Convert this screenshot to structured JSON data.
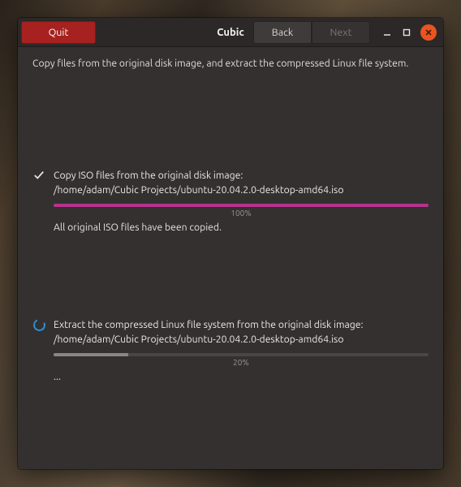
{
  "header": {
    "quit_label": "Quit",
    "app_title": "Cubic",
    "back_label": "Back",
    "next_label": "Next"
  },
  "description": "Copy files from the original disk image, and extract the compressed Linux file system.",
  "tasks": [
    {
      "icon": "check",
      "title": "Copy ISO files from the original disk image:",
      "path": "/home/adam/Cubic Projects/ubuntu-20.04.2.0-desktop-amd64.iso",
      "progress_percent": 100,
      "progress_label": "100%",
      "status": "All original ISO files have been copied."
    },
    {
      "icon": "spinner",
      "title": "Extract the compressed Linux file system from the original disk image:",
      "path": "/home/adam/Cubic Projects/ubuntu-20.04.2.0-desktop-amd64.iso",
      "progress_percent": 20,
      "progress_label": "20%",
      "status": "..."
    }
  ],
  "colors": {
    "accent_progress": "#b8328d",
    "quit_button": "#a6211f",
    "close_button": "#e95420",
    "spinner": "#2f8ed0"
  }
}
